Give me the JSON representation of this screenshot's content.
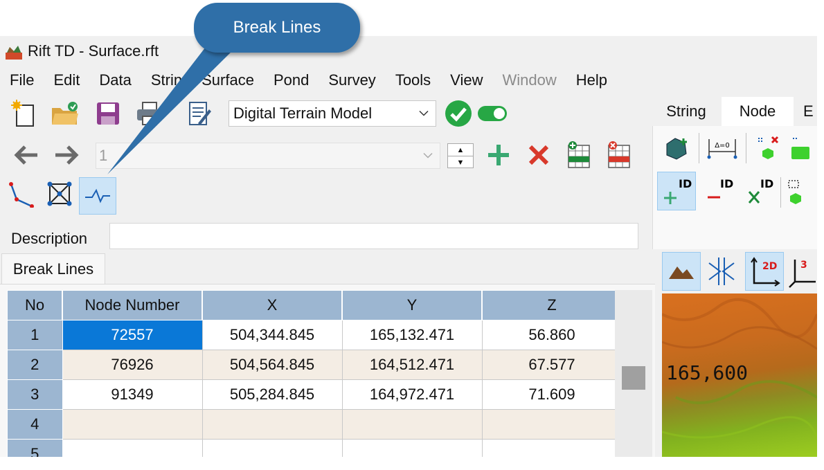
{
  "callout": {
    "text": "Break Lines"
  },
  "window": {
    "title": "Rift TD - Surface.rft"
  },
  "menu": [
    {
      "label": "File",
      "disabled": false
    },
    {
      "label": "Edit",
      "disabled": false
    },
    {
      "label": "Data",
      "disabled": false
    },
    {
      "label": "Strin",
      "disabled": false
    },
    {
      "label": "Surface",
      "disabled": false
    },
    {
      "label": "Pond",
      "disabled": false
    },
    {
      "label": "Survey",
      "disabled": false
    },
    {
      "label": "Tools",
      "disabled": false
    },
    {
      "label": "View",
      "disabled": false
    },
    {
      "label": "Window",
      "disabled": true
    },
    {
      "label": "Help",
      "disabled": false
    }
  ],
  "toolbar": {
    "surface_combo_value": "Digital Terrain Model",
    "string_combo_value": "1"
  },
  "description": {
    "label": "Description",
    "value": ""
  },
  "tab": {
    "label": "Break Lines"
  },
  "grid": {
    "columns": [
      "No",
      "Node Number",
      "X",
      "Y",
      "Z"
    ],
    "rows": [
      {
        "no": "1",
        "node": "72557",
        "x": "504,344.845",
        "y": "165,132.471",
        "z": "56.860"
      },
      {
        "no": "2",
        "node": "76926",
        "x": "504,564.845",
        "y": "164,512.471",
        "z": "67.577"
      },
      {
        "no": "3",
        "node": "91349",
        "x": "505,284.845",
        "y": "164,972.471",
        "z": "71.609"
      },
      {
        "no": "4",
        "node": "",
        "x": "",
        "y": "",
        "z": ""
      },
      {
        "no": "5",
        "node": "",
        "x": "",
        "y": "",
        "z": ""
      }
    ]
  },
  "right_panel": {
    "tabs": [
      "String",
      "Node",
      "E"
    ],
    "active_tab": "Node",
    "id_label": "ID",
    "delta_label": "Δ=0",
    "view_labels": [
      "2D",
      "3"
    ]
  },
  "map": {
    "label": "165,600"
  },
  "colors": {
    "accent": "#0a78d7",
    "grid_header": "#9cb6d1",
    "alt_row": "#f4ede4",
    "callout": "#2f6fa8"
  }
}
